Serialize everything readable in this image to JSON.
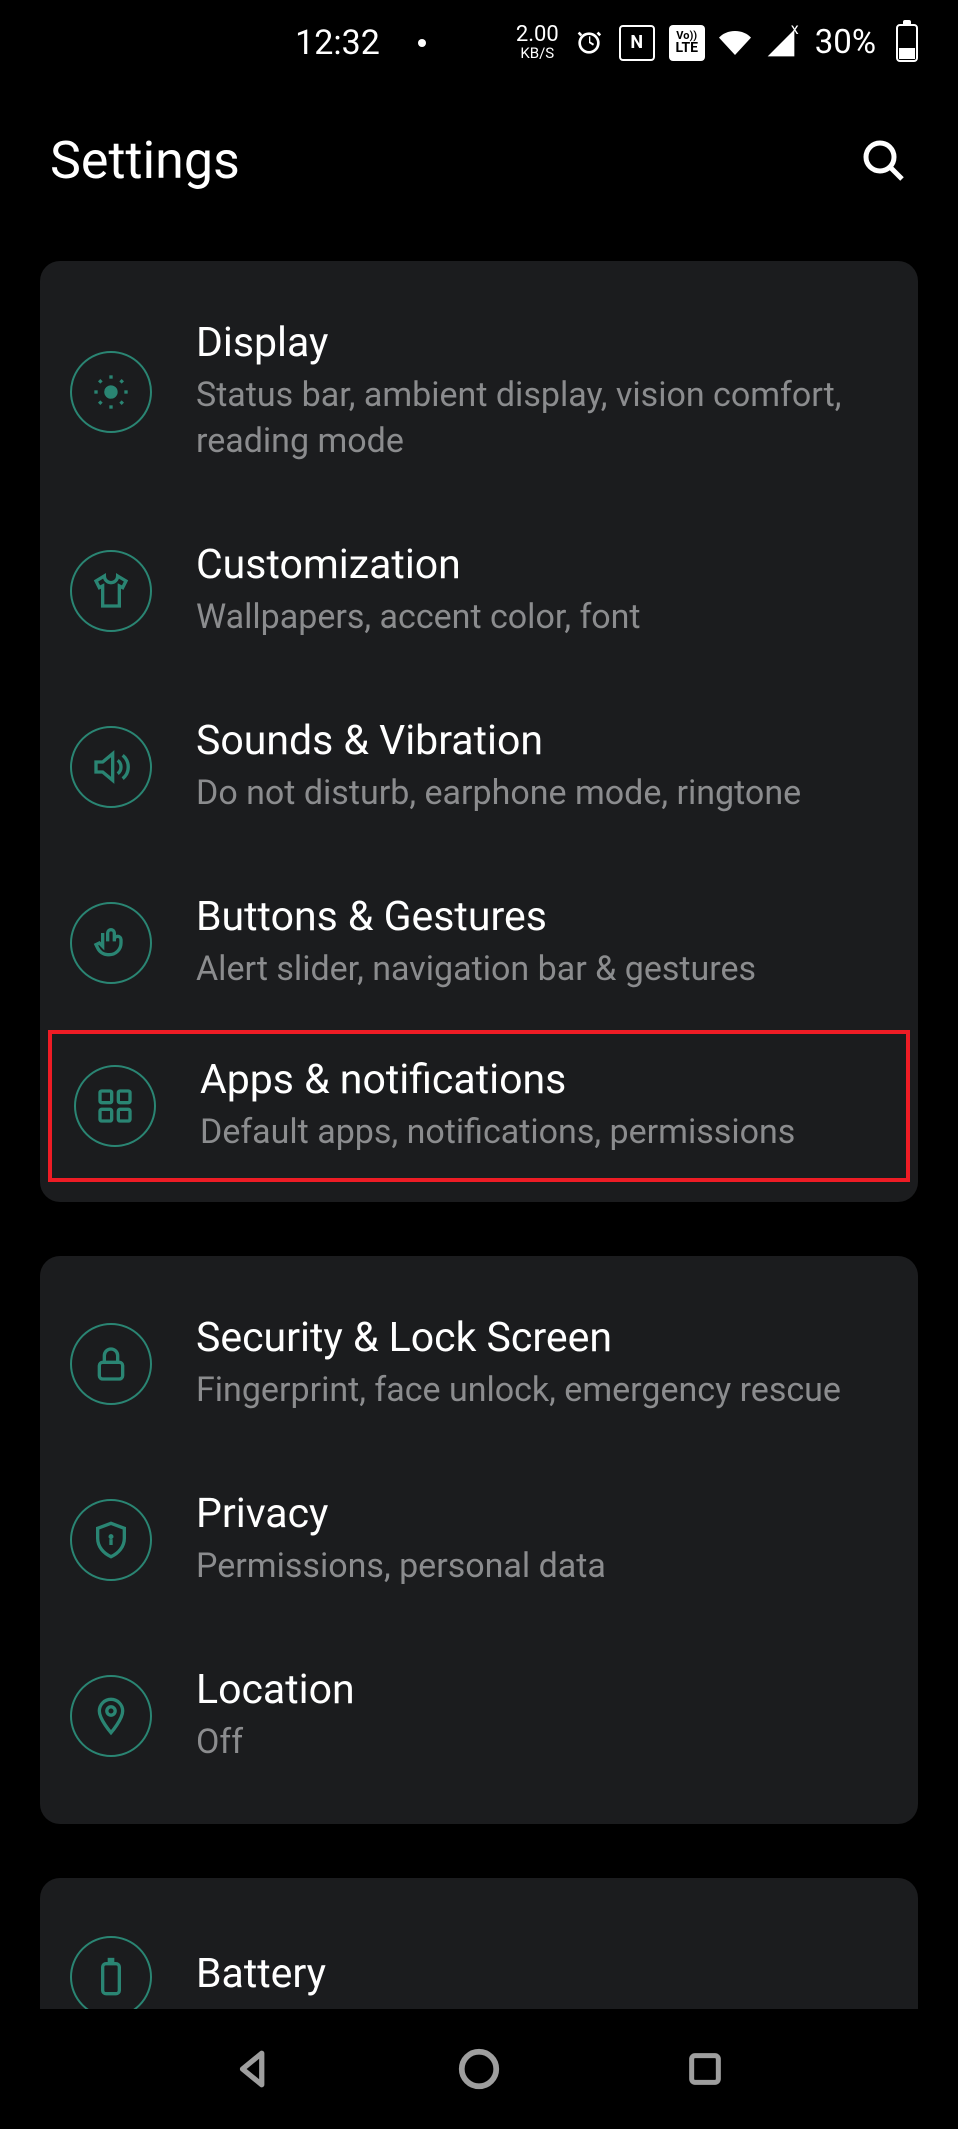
{
  "status_bar": {
    "time": "12:32",
    "net_speed_value": "2.00",
    "net_speed_unit": "KB/S",
    "nfc_label": "N",
    "volte_top": "Vo))",
    "volte_bottom": "LTE",
    "cell_badge": "x",
    "battery_pct": "30%"
  },
  "header": {
    "title": "Settings"
  },
  "groups": [
    {
      "items": [
        {
          "icon": "brightness",
          "title": "Display",
          "subtitle": "Status bar, ambient display, vision comfort, reading mode",
          "highlighted": false,
          "name": "settings-item-display"
        },
        {
          "icon": "shirt",
          "title": "Customization",
          "subtitle": "Wallpapers, accent color, font",
          "highlighted": false,
          "name": "settings-item-customization"
        },
        {
          "icon": "volume",
          "title": "Sounds & Vibration",
          "subtitle": "Do not disturb, earphone mode, ringtone",
          "highlighted": false,
          "name": "settings-item-sounds"
        },
        {
          "icon": "tap",
          "title": "Buttons & Gestures",
          "subtitle": "Alert slider, navigation bar & gestures",
          "highlighted": false,
          "name": "settings-item-buttons"
        },
        {
          "icon": "apps",
          "title": "Apps & notifications",
          "subtitle": "Default apps, notifications, permissions",
          "highlighted": true,
          "name": "settings-item-apps"
        }
      ]
    },
    {
      "items": [
        {
          "icon": "lock",
          "title": "Security & Lock Screen",
          "subtitle": "Fingerprint, face unlock, emergency rescue",
          "highlighted": false,
          "name": "settings-item-security"
        },
        {
          "icon": "shield",
          "title": "Privacy",
          "subtitle": "Permissions, personal data",
          "highlighted": false,
          "name": "settings-item-privacy"
        },
        {
          "icon": "pin",
          "title": "Location",
          "subtitle": "Off",
          "highlighted": false,
          "name": "settings-item-location"
        }
      ]
    },
    {
      "items": [
        {
          "icon": "battery",
          "title": "Battery",
          "subtitle": "",
          "highlighted": false,
          "name": "settings-item-battery"
        }
      ]
    }
  ],
  "accent_color": "#2a8573",
  "highlight_color": "#ee1c25"
}
